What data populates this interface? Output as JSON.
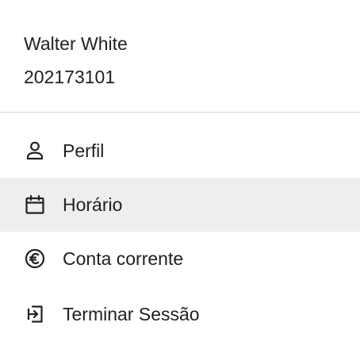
{
  "user": {
    "name": "Walter White",
    "id": "202173101"
  },
  "menu": {
    "items": [
      {
        "label": "Perfil",
        "icon": "person-icon",
        "active": false
      },
      {
        "label": "Horário",
        "icon": "calendar-icon",
        "active": true
      },
      {
        "label": "Conta corrente",
        "icon": "euro-icon",
        "active": false
      },
      {
        "label": "Terminar Sessão",
        "icon": "logout-icon",
        "active": false
      }
    ]
  },
  "colors": {
    "text": "#212121",
    "active_background": "#eeeeee",
    "divider": "#d6d6d6"
  }
}
